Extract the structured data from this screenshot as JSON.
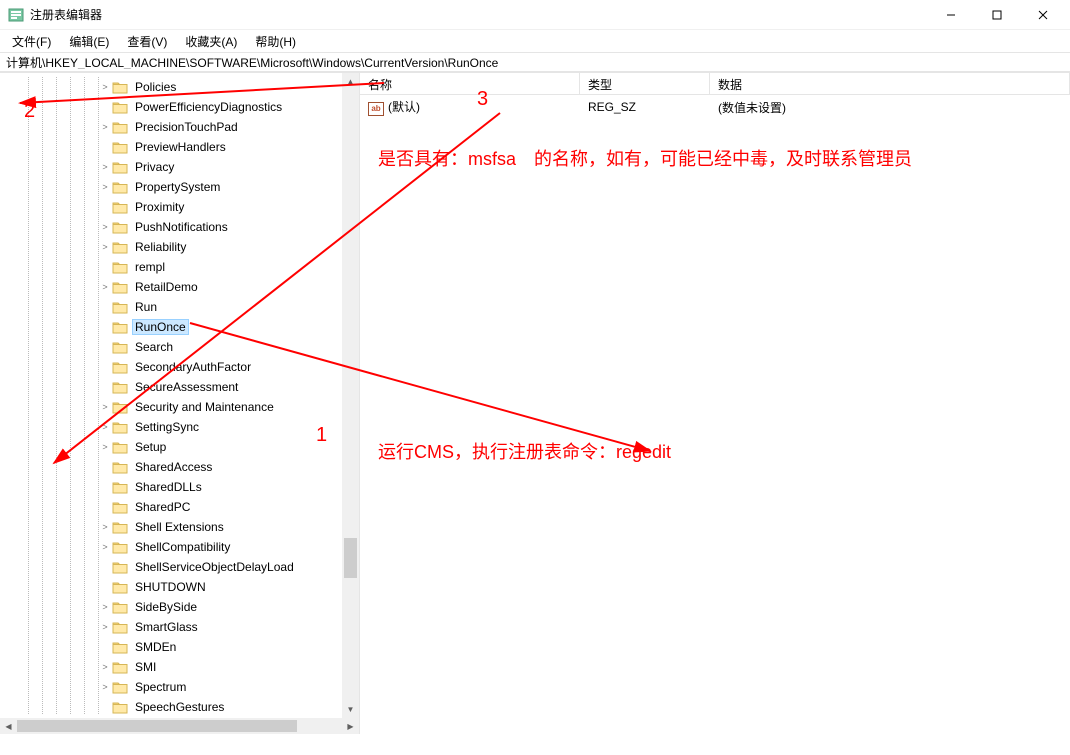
{
  "window": {
    "title": "注册表编辑器",
    "controls": {
      "min": "—",
      "max": "☐",
      "close": "✕"
    }
  },
  "menu": {
    "file": "文件(F)",
    "edit": "编辑(E)",
    "view": "查看(V)",
    "favorites": "收藏夹(A)",
    "help": "帮助(H)"
  },
  "address": "计算机\\HKEY_LOCAL_MACHINE\\SOFTWARE\\Microsoft\\Windows\\CurrentVersion\\RunOnce",
  "tree": {
    "items": [
      {
        "label": "Policies",
        "expandable": true
      },
      {
        "label": "PowerEfficiencyDiagnostics"
      },
      {
        "label": "PrecisionTouchPad",
        "expandable": true
      },
      {
        "label": "PreviewHandlers"
      },
      {
        "label": "Privacy",
        "expandable": true
      },
      {
        "label": "PropertySystem",
        "expandable": true
      },
      {
        "label": "Proximity"
      },
      {
        "label": "PushNotifications",
        "expandable": true
      },
      {
        "label": "Reliability",
        "expandable": true
      },
      {
        "label": "rempl"
      },
      {
        "label": "RetailDemo",
        "expandable": true
      },
      {
        "label": "Run"
      },
      {
        "label": "RunOnce",
        "selected": true
      },
      {
        "label": "Search"
      },
      {
        "label": "SecondaryAuthFactor"
      },
      {
        "label": "SecureAssessment"
      },
      {
        "label": "Security and Maintenance",
        "expandable": true
      },
      {
        "label": "SettingSync",
        "expandable": true
      },
      {
        "label": "Setup",
        "expandable": true
      },
      {
        "label": "SharedAccess"
      },
      {
        "label": "SharedDLLs"
      },
      {
        "label": "SharedPC"
      },
      {
        "label": "Shell Extensions",
        "expandable": true
      },
      {
        "label": "ShellCompatibility",
        "expandable": true
      },
      {
        "label": "ShellServiceObjectDelayLoad"
      },
      {
        "label": "SHUTDOWN"
      },
      {
        "label": "SideBySide",
        "expandable": true
      },
      {
        "label": "SmartGlass",
        "expandable": true
      },
      {
        "label": "SMDEn"
      },
      {
        "label": "SMI",
        "expandable": true
      },
      {
        "label": "Spectrum",
        "expandable": true
      },
      {
        "label": "SpeechGestures"
      }
    ]
  },
  "list": {
    "columns": {
      "name": "名称",
      "type": "类型",
      "data": "数据"
    },
    "rows": [
      {
        "name": "(默认)",
        "type": "REG_SZ",
        "data": "(数值未设置)"
      }
    ]
  },
  "annotations": {
    "num1": "1",
    "num2": "2",
    "num3": "3",
    "line1": "是否具有：msfsa 的名称，如有，可能已经中毒，及时联系管理员",
    "line2": "运行CMS，执行注册表命令：regedit"
  }
}
